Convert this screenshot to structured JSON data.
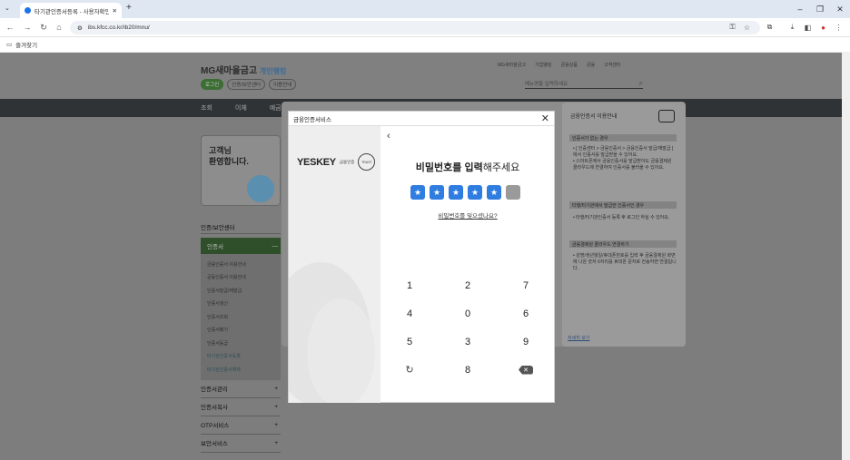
{
  "browser": {
    "tab_title": "타기관인증서등록 - 사용자확인",
    "url": "ibs.kfcc.co.kr/ib20/mnu/",
    "bookmark": "즐겨찾기"
  },
  "site": {
    "logo": "MG새마을금고",
    "logo_sub": "개인뱅킹",
    "chips": [
      "로그인",
      "인증/보안센터",
      "이용안내"
    ],
    "top_links": [
      "MG새마을금고",
      "기업뱅킹",
      "금융상품",
      "금융",
      "고객센터"
    ],
    "search_placeholder": "메뉴명을 입력하세요",
    "gnb": [
      "조회",
      "이체",
      "예금"
    ],
    "welcome": "고객님\n환영합니다.",
    "lnav_title": "인증/보안센터",
    "lnav_selected": "인증서",
    "lnav_sub": [
      "금융인증서 이용안내",
      "공동인증서 이용안내",
      "인증서발급/재발급",
      "인증서갱신",
      "인증서조회",
      "인증서폐기",
      "인증서등급",
      "타기관인증서등록",
      "타기관인증서해제"
    ],
    "lnav_more": [
      "인증서관리",
      "인증서복사",
      "OTP서비스",
      "보안서비스"
    ]
  },
  "modal": {
    "header": "금융인증서비스",
    "brand": "YESKEY",
    "brand_sub": "금융인증",
    "seal_text": "TRUST",
    "title_bold": "비밀번호를 입력",
    "title_rest": "해주세요",
    "filled_count": 5,
    "total_count": 6,
    "dot_symbol": "★",
    "forgot": "비밀번호를 잊으셨나요?",
    "keys": [
      "1",
      "2",
      "7",
      "4",
      "0",
      "6",
      "5",
      "3",
      "9",
      "↻",
      "8",
      "✕"
    ]
  },
  "guide": {
    "title": "금융인증서 이용안내",
    "sections": [
      {
        "head": "인증서가 없는 경우",
        "text": "• [ 인증센터 > 금융인증서 > 금융인증서 발급/재발급 ] 에서 인증서를 발급받을 수 있어요.\n• 스마트폰에서 금융인증서를 발급받아도 금융결제원 클라우드에 연결하여 인증서를 불러올 수 있어요."
      },
      {
        "head": "타행/타기관에서 발급한 인증서인 경우",
        "text": "• 타행/타기관인증서 등록 후 로그인 하실 수 있어요."
      },
      {
        "head": "금융결제원 클라우드 연결하기",
        "text": "• 성명/생년월일/휴대폰번호를 입력 후 금융결제원 화면에 나온 숫자 6자리를 휴대폰 문자로 전송하면 연결됩니다."
      }
    ],
    "more": "자세히 보기"
  }
}
